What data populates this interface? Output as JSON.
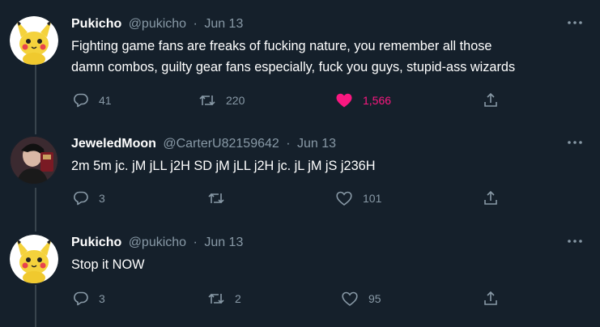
{
  "tweets": [
    {
      "name": "Pukicho",
      "handle": "@pukicho",
      "date": "Jun 13",
      "text_lines": [
        "Fighting game fans are freaks of fucking nature, you remember all those",
        "damn combos, guilty gear fans especially, fuck you guys, stupid-ass wizards"
      ],
      "replies": "41",
      "retweets": "220",
      "likes": "1,566",
      "liked": true,
      "avatar": "pikachu-avatar"
    },
    {
      "name": "JeweledMoon",
      "handle": "@CarterU82159642",
      "date": "Jun 13",
      "text_lines": [
        "2m 5m jc. jM jLL j2H SD jM jLL j2H jc. jL jM jS j236H"
      ],
      "replies": "3",
      "retweets": "",
      "likes": "101",
      "liked": false,
      "avatar": "photo-avatar"
    },
    {
      "name": "Pukicho",
      "handle": "@pukicho",
      "date": "Jun 13",
      "text_lines": [
        "Stop it NOW"
      ],
      "replies": "3",
      "retweets": "2",
      "likes": "95",
      "liked": false,
      "avatar": "pikachu-avatar"
    }
  ],
  "colors": {
    "background": "#15202b",
    "muted": "#8899a6",
    "like_pink": "#f91880",
    "thread_line": "#38444d"
  }
}
